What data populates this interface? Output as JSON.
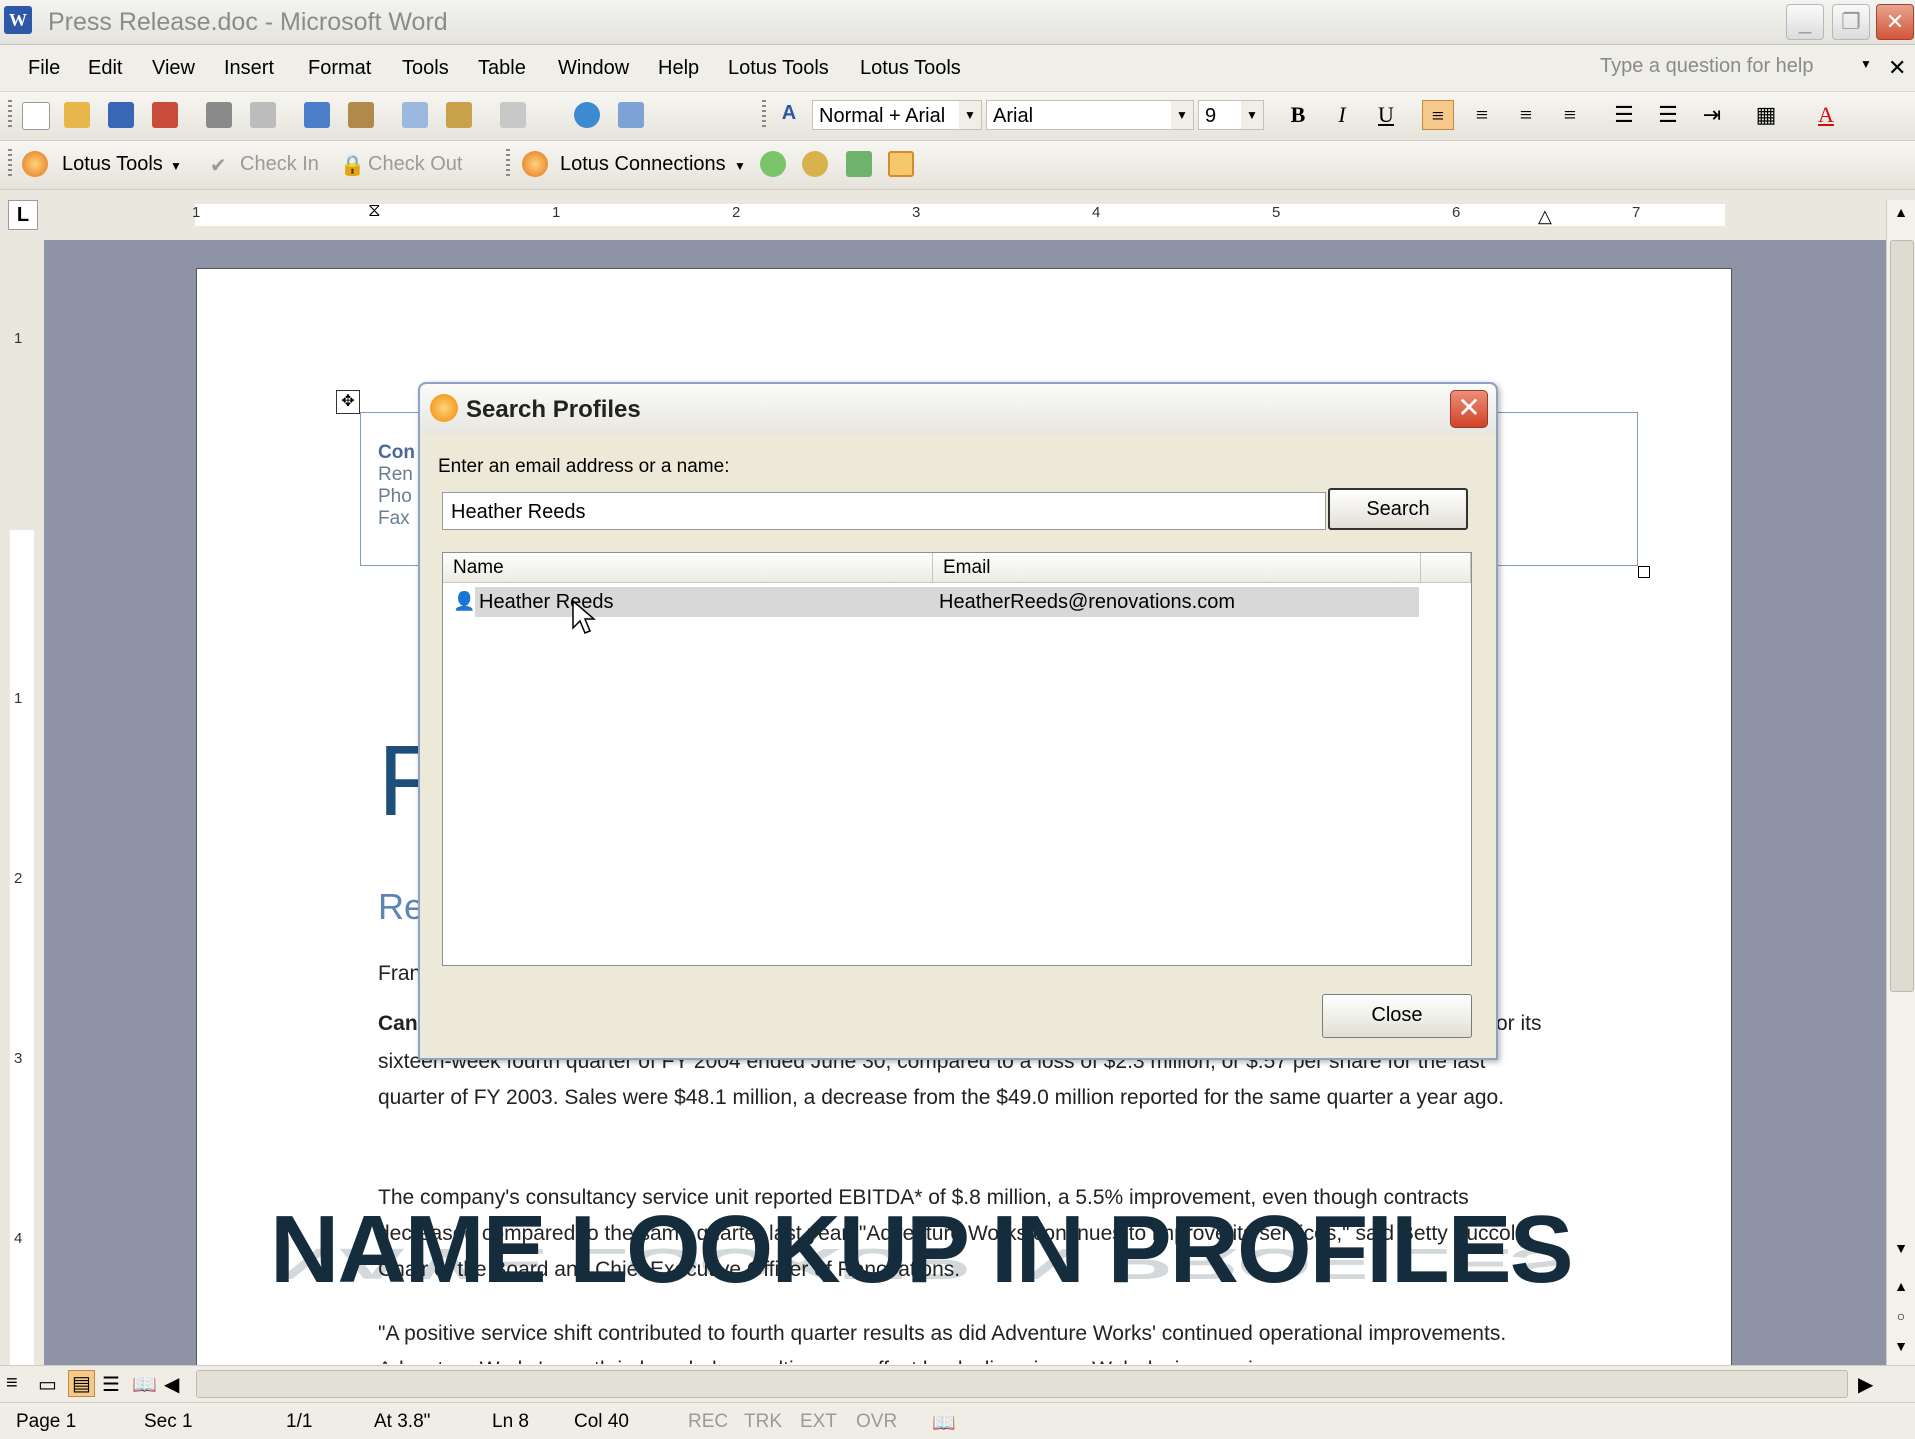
{
  "window": {
    "title": "Press Release.doc - Microsoft Word"
  },
  "menu": [
    "File",
    "Edit",
    "View",
    "Insert",
    "Format",
    "Tools",
    "Table",
    "Window",
    "Help",
    "Lotus Tools",
    "Lotus Tools"
  ],
  "help_box": {
    "placeholder": "Type a question for help"
  },
  "formatting": {
    "style": "Normal + Arial",
    "font": "Arial",
    "size": "9"
  },
  "lotus_toolbar": {
    "lotus_tools": "Lotus Tools",
    "check_in": "Check In",
    "check_out": "Check Out",
    "lotus_connections": "Lotus Connections"
  },
  "ruler_numbers": [
    "1",
    "1",
    "2",
    "3",
    "4",
    "5",
    "6",
    "7"
  ],
  "vruler_numbers": [
    "1",
    "1",
    "2",
    "3",
    "4"
  ],
  "document": {
    "contact_lines": [
      "Con",
      "Ren",
      "Pho",
      "Fax"
    ],
    "big_letter": "F",
    "subhead": "Re",
    "from_line": "Fran",
    "bold_lead": "Can",
    "line_a_tail": "or its",
    "para1": "sixteen-week fourth quarter of FY 2004 ended June 30, compared to a loss of $2.3 million, or $.57 per share for the last quarter of FY 2003. Sales were $48.1 million, a decrease from the $49.0 million reported for the same quarter a year ago.",
    "para2": "The company's consultancy service unit reported EBITDA* of $.8 million, a 5.5% improvement, even though contracts decreased compared to the same quarter last year. \"Adventure Works continues to improve its services,\" said Betty Zuccola, Chair of the Board and Chief Executive Officer of Renovations.",
    "para3": "\"A positive service shift contributed to fourth quarter results as did Adventure Works' continued operational improvements. Adventure Works' growth in branded consulting was offset by declines in our Web design service"
  },
  "overlay_caption": "NAME LOOKUP IN PROFILES",
  "dialog": {
    "title": "Search Profiles",
    "prompt": "Enter an email address or a name:",
    "query": "Heather Reeds",
    "search_button": "Search",
    "columns": [
      "Name",
      "Email"
    ],
    "results": [
      {
        "name": "Heather Reeds",
        "email": "HeatherReeds@renovations.com"
      }
    ],
    "close_button": "Close"
  },
  "status": {
    "page": "Page  1",
    "sec": "Sec  1",
    "pages": "1/1",
    "at": "At  3.8\"",
    "ln": "Ln  8",
    "col": "Col  40",
    "rec": "REC",
    "trk": "TRK",
    "ext": "EXT",
    "ovr": "OVR"
  },
  "colors": {
    "accent": "#2d58a7",
    "close_red": "#d2553a",
    "overlay_text": "#142c3b"
  }
}
